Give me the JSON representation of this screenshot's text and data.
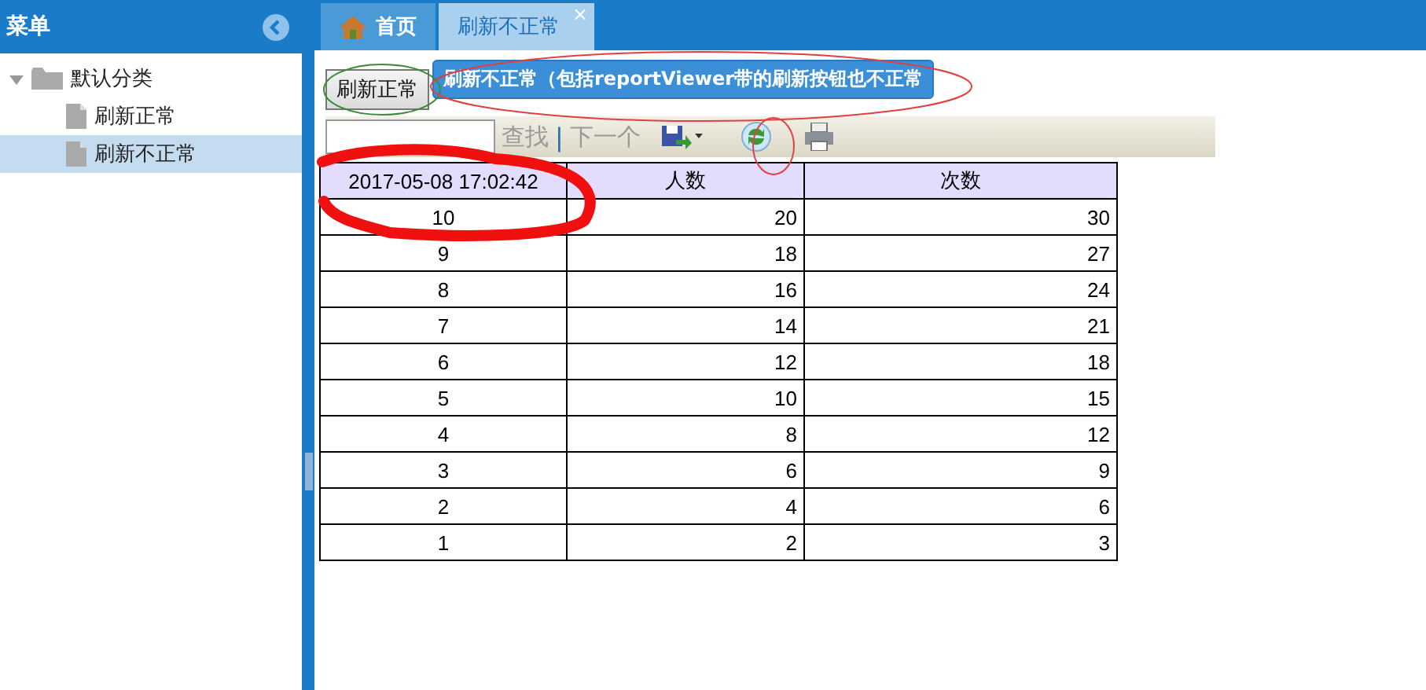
{
  "sidebar": {
    "title": "菜单",
    "tree": [
      {
        "label": "默认分类",
        "kind": "folder",
        "expanded": true,
        "selected": false,
        "children": [
          {
            "label": "刷新正常",
            "kind": "file",
            "selected": false
          },
          {
            "label": "刷新不正常",
            "kind": "file",
            "selected": true
          }
        ]
      }
    ]
  },
  "tabs": [
    {
      "label": "首页",
      "selected": false,
      "closable": false,
      "kind": "home"
    },
    {
      "label": "刷新不正常",
      "selected": true,
      "closable": true,
      "kind": "plain"
    }
  ],
  "close_glyph": "×",
  "buttons": [
    {
      "label": "刷新正常",
      "kind": "plain"
    },
    {
      "label": "刷新不正常（包括reportViewer带的刷新按钮也不正常",
      "kind": "primary"
    }
  ],
  "report_toolbar": {
    "find_label": "查找",
    "separator": "|",
    "next_label": "下一个"
  },
  "table": {
    "columns": [
      "2017-05-08 17:02:42",
      "人数",
      "次数"
    ],
    "rows": [
      [
        "10",
        "20",
        "30"
      ],
      [
        "9",
        "18",
        "27"
      ],
      [
        "8",
        "16",
        "24"
      ],
      [
        "7",
        "14",
        "21"
      ],
      [
        "6",
        "12",
        "18"
      ],
      [
        "5",
        "10",
        "15"
      ],
      [
        "4",
        "8",
        "12"
      ],
      [
        "3",
        "6",
        "9"
      ],
      [
        "2",
        "4",
        "6"
      ],
      [
        "1",
        "2",
        "3"
      ]
    ]
  }
}
